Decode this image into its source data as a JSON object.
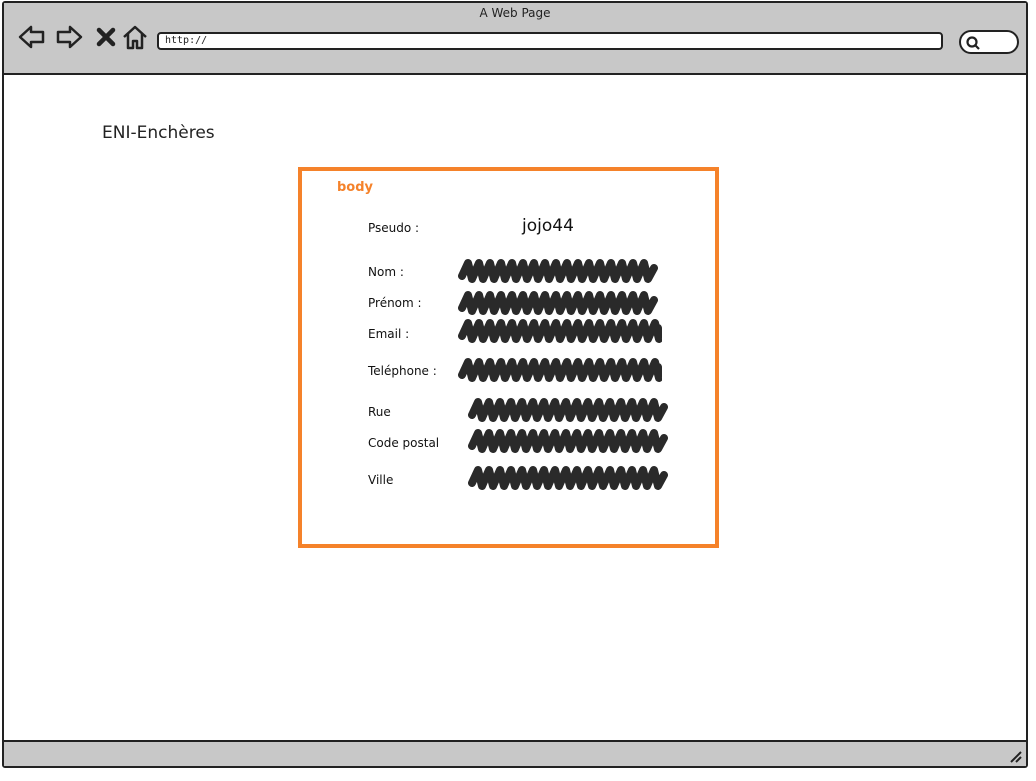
{
  "browser": {
    "window_title": "A Web Page",
    "url": "http://",
    "icons": [
      "back-arrow-icon",
      "forward-arrow-icon",
      "close-x-icon",
      "home-icon",
      "search-icon",
      "resize-grip-icon"
    ]
  },
  "page": {
    "site_title": "ENI-Enchères",
    "panel": {
      "tag": "body",
      "pseudo_label": "Pseudo :",
      "pseudo_value": "jojo44",
      "fields": [
        {
          "label": "Nom :",
          "value_redacted": true
        },
        {
          "label": "Prénom :",
          "value_redacted": true
        },
        {
          "label": "Email :",
          "value_redacted": true
        },
        {
          "label": "Teléphone :",
          "value_redacted": true
        },
        {
          "label": "Rue",
          "value_redacted": true
        },
        {
          "label": "Code postal",
          "value_redacted": true
        },
        {
          "label": "Ville",
          "value_redacted": true
        }
      ]
    }
  },
  "colors": {
    "accent": "#f5822a",
    "chrome": "#c8c8c8",
    "ink": "#222222"
  }
}
